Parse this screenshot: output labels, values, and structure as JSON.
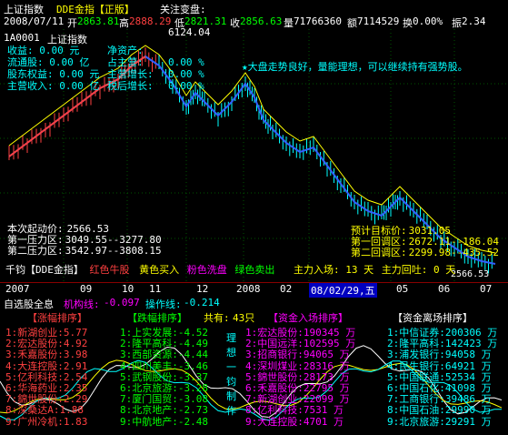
{
  "topbar": {
    "title": "上证指数",
    "indicator": "DDE金指【正版】",
    "focus": "关注变盘:",
    "date": "2008/07/11",
    "open_label": "开",
    "open": "2863.81",
    "high_label": "高",
    "high": "2888.29",
    "low_label": "低",
    "low": "2821.31",
    "close_label": "收",
    "close": "2856.63",
    "volume_label": "量",
    "volume": "71766360",
    "amount_label": "额",
    "amount": "7114529",
    "turnover_label": "换",
    "turnover": "0.00%",
    "amplitude_label": "振",
    "amplitude": "2.34"
  },
  "info": {
    "code": "1A0001",
    "name": "上证指数",
    "peak": "6124.04",
    "rows": [
      {
        "label": "收益:",
        "value": "0.00",
        "unit": "元",
        "label2": "净资产:"
      },
      {
        "label": "流通股:",
        "value": "0.00",
        "unit": "亿",
        "label2": "占主营:"
      },
      {
        "label": "股东权益:",
        "value": "0.00",
        "unit": "元",
        "label2": "主营增长:"
      },
      {
        "label": "主营收入:",
        "value": "0.00",
        "unit": "亿",
        "label2": "税后增长:"
      }
    ],
    "pct": [
      "0.00 %",
      "0.00 %",
      "0.00 %"
    ]
  },
  "annotation": "★大盘走势良好，量能理想，可以继续持有强势股。",
  "levels": {
    "start_label": "本次起动价:",
    "start": "2566.53",
    "press1_label": "第一压力区:",
    "press1": "3049.55--3277.80",
    "press2_label": "第二压力区:",
    "press2": "3542.97--3808.15",
    "target_label": "预计目标价:",
    "target": "3031.05",
    "pull1_label": "第一回调区:",
    "pull1": "2672.11--186.04",
    "pull2_label": "第二回调区:",
    "pull2": "2299.98--435.52",
    "low_mark": "2566.53"
  },
  "legend": {
    "brand": "千钧【DDE金指】",
    "red": "红色牛股",
    "yellow": "黄色买入",
    "pink": "粉色洗盘",
    "green": "绿色卖出",
    "main_in": "主力入场:",
    "main_in_val": "13 天",
    "main_back": "主力回吐:",
    "main_back_val": "0 天"
  },
  "axis": {
    "labels": [
      "2007",
      "09",
      "10",
      "11",
      "12",
      "2008",
      "02"
    ],
    "cursor_date": "08/02/29,五",
    "labels2": [
      "05",
      "06",
      "07"
    ]
  },
  "bottom": {
    "left_title": "自选股全息",
    "agency_label": "机构线:",
    "agency_val": "-0.097",
    "op_label": "操作线:",
    "op_val": "-0.214",
    "rise_title": "【涨幅排序】",
    "fall_title": "【跌幅排序】",
    "total_label": "共有:",
    "total_val": "43只",
    "inflow_title": "【资金入场排序】",
    "outflow_title": "【资金离场排序】",
    "watermark": "理想一钧制作",
    "rise": [
      [
        "1:",
        "新湖创业:",
        "5.77"
      ],
      [
        "2:",
        "宏达股份:",
        "4.92"
      ],
      [
        "3:",
        "禾嘉股份:",
        "3.98"
      ],
      [
        "4:",
        "大连控股:",
        "2.91"
      ],
      [
        "5:",
        "亿利科技:",
        "2.54"
      ],
      [
        "6:",
        "华海药业:",
        "2.35"
      ],
      [
        "7:",
        "錦世股份:",
        "2.29"
      ],
      [
        "8:",
        "深桑达A:",
        "1.88"
      ],
      [
        "9:",
        "广州冷机:",
        "1.83"
      ]
    ],
    "fall": [
      [
        "1:",
        "上实发展:",
        "-4.52"
      ],
      [
        "2:",
        "隆平高科:",
        "-4.49"
      ],
      [
        "3:",
        "西部资源:",
        "-4.44"
      ],
      [
        "4:",
        "四川美丰:",
        "-3.46"
      ],
      [
        "5:",
        "武钢股份:",
        "-3.37"
      ],
      [
        "6:",
        "北京旅游:",
        "-3.28"
      ],
      [
        "7:",
        "厦门国贸:",
        "-3.08"
      ],
      [
        "8:",
        "北京地产:",
        "-2.73"
      ],
      [
        "9:",
        "中航地产:",
        "-2.48"
      ]
    ],
    "inflow": [
      [
        "1:",
        "宏达股份:",
        "190345",
        "万"
      ],
      [
        "2:",
        "中国远洋:",
        "102595",
        "万"
      ],
      [
        "3:",
        "招商银行:",
        "94065",
        "万"
      ],
      [
        "4:",
        "深圳煤业:",
        "28316",
        "万"
      ],
      [
        "5:",
        "錦世股份:",
        "28173",
        "万"
      ],
      [
        "6:",
        "禾嘉股份:",
        "22795",
        "万"
      ],
      [
        "7:",
        "新湖创业:",
        "22099",
        "万"
      ],
      [
        "8:",
        "亿利科技:",
        "7531",
        "万"
      ],
      [
        "9:",
        "大连控股:",
        "4701",
        "万"
      ]
    ],
    "outflow": [
      [
        "1:",
        "中信证券:",
        "200306",
        "万"
      ],
      [
        "2:",
        "隆平高科:",
        "142423",
        "万"
      ],
      [
        "3:",
        "浦发银行:",
        "94058",
        "万"
      ],
      [
        "4:",
        "民生银行:",
        "64921",
        "万"
      ],
      [
        "5:",
        "中国联通:",
        "52534",
        "万"
      ],
      [
        "6:",
        "中国石化:",
        "41098",
        "万"
      ],
      [
        "7:",
        "工商银行:",
        "39486",
        "万"
      ],
      [
        "8:",
        "中国石油:",
        "29990",
        "万"
      ],
      [
        "9:",
        "北京旅游:",
        "29291",
        "万"
      ]
    ]
  },
  "colors": {
    "red": "#ff4040",
    "yellow": "#ffff00",
    "green": "#00ff00",
    "cyan": "#00ffff",
    "magenta": "#ff00ff",
    "blue": "#3060ff",
    "white": "#ffffff"
  }
}
